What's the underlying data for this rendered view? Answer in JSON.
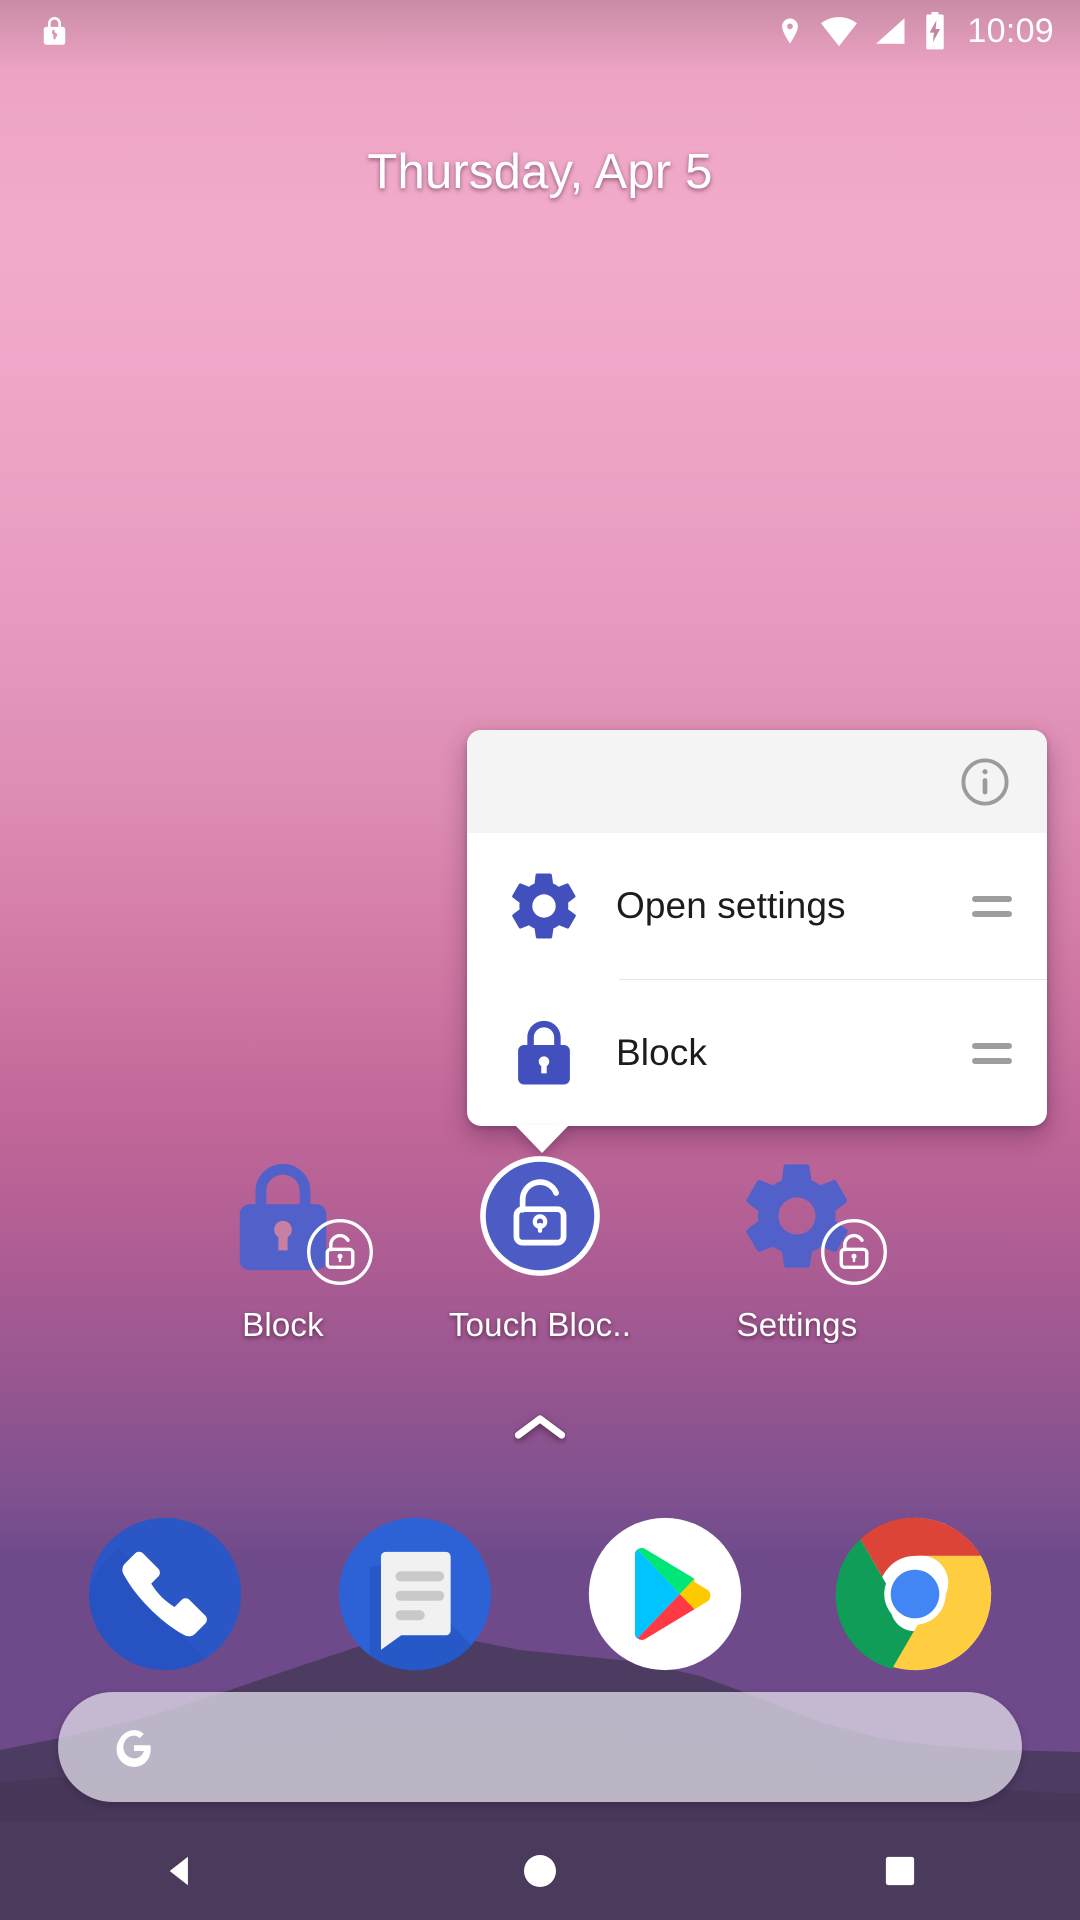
{
  "status_bar": {
    "left_icons": [
      {
        "name": "lock-icon",
        "label": "lock"
      }
    ],
    "right_icons": [
      {
        "name": "location-icon",
        "label": "location"
      },
      {
        "name": "wifi-icon",
        "label": "wifi"
      },
      {
        "name": "cell-signal-icon",
        "label": "signal"
      },
      {
        "name": "battery-charging-icon",
        "label": "battery charging"
      }
    ],
    "clock": "10:09"
  },
  "date_widget": {
    "text": "Thursday, Apr 5"
  },
  "popup": {
    "info_icon": "info-icon",
    "items": [
      {
        "label": "Open settings",
        "icon": "gear-icon",
        "handle": "drag-handle-icon"
      },
      {
        "label": "Block",
        "icon": "lock-closed-icon",
        "handle": "drag-handle-icon"
      }
    ]
  },
  "shortcuts": [
    {
      "label": "Block",
      "icon": "lock-closed-icon",
      "badge": "lock-open-badge-icon",
      "selected": false
    },
    {
      "label": "Touch Bloc..",
      "icon": "lock-open-circle-icon",
      "badge": "",
      "selected": true
    },
    {
      "label": "Settings",
      "icon": "gear-icon",
      "badge": "lock-open-badge-icon",
      "selected": false
    }
  ],
  "all_apps": {
    "icon": "chevron-up-icon",
    "label": "All apps"
  },
  "dock": [
    {
      "name": "phone",
      "icon": "phone-icon"
    },
    {
      "name": "messages",
      "icon": "messages-icon"
    },
    {
      "name": "play-store",
      "icon": "play-store-icon"
    },
    {
      "name": "chrome",
      "icon": "chrome-icon"
    }
  ],
  "search_bar": {
    "logo": "google-g-icon",
    "value": "",
    "placeholder": ""
  },
  "nav_bar": [
    {
      "name": "back",
      "icon": "back-triangle-icon"
    },
    {
      "name": "home",
      "icon": "home-circle-icon"
    },
    {
      "name": "recents",
      "icon": "recents-square-icon"
    }
  ],
  "colors": {
    "accent_blue": "#4250bd",
    "icon_blue": "#4a5bc4",
    "popup_header": "#f4f4f4",
    "popup_body": "#ffffff",
    "navbar": "#4a3a5c",
    "text_dark": "#1c1c1c",
    "text_light": "#ffffff"
  }
}
